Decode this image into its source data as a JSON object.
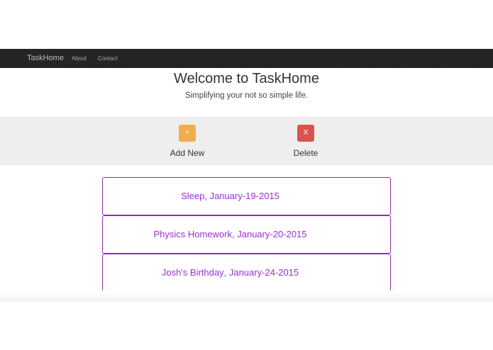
{
  "navbar": {
    "brand": "TaskHome",
    "links": [
      "About",
      "Contact"
    ]
  },
  "hero": {
    "title": "Welcome to TaskHome",
    "subtitle": "Simplifying your not so simple life."
  },
  "actions": {
    "add": {
      "symbol": "+",
      "label": "Add New"
    },
    "delete": {
      "symbol": "X",
      "label": "Delete"
    }
  },
  "tasks": [
    {
      "name": "Sleep",
      "date": "January-19-2015"
    },
    {
      "name": "Physics Homework",
      "date": "January-20-2015"
    },
    {
      "name": "Josh's Birthday",
      "date": "January-24-2015"
    }
  ],
  "colors": {
    "navbar": "#222222",
    "add_button": "#f0ad4e",
    "delete_button": "#d9534f",
    "task_border": "#8e2db7",
    "task_text": "#9a2fd1"
  }
}
